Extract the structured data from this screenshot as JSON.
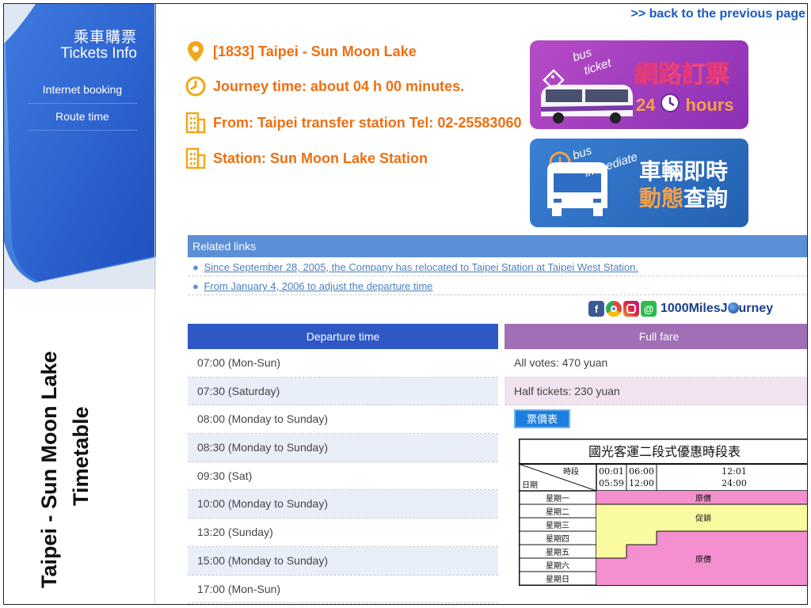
{
  "sidebar": {
    "brand_zh": "乘車購票",
    "brand_en": "Tickets Info",
    "nav": [
      {
        "label": "Internet booking"
      },
      {
        "label": "Route time"
      }
    ],
    "vertical_title_line1": "Taipei - Sun Moon Lake",
    "vertical_title_line2": "Timetable"
  },
  "header": {
    "back_link": ">> back to the previous page"
  },
  "route": {
    "name": "[1833] Taipei - Sun Moon Lake",
    "journey": "Journey time: about 04 h 00 minutes.",
    "from": "From: Taipei transfer station Tel: 02-25583060",
    "station": "Station: Sun Moon Lake Station"
  },
  "banners": {
    "ticket": {
      "small1": "bus",
      "small2": "ticket",
      "title": "網路訂票",
      "hours_num": "24",
      "hours_word": "hours"
    },
    "bus": {
      "small1": "bus",
      "small2": "immediate",
      "line1": "車輛即時",
      "line2_a": "動態",
      "line2_b": "查詢"
    }
  },
  "related": {
    "heading": "Related links",
    "links": [
      "Since September 28, 2005, the Company has relocated to Taipei Station at Taipei West Station.",
      "From January 4, 2006 to adjust the departure time"
    ]
  },
  "social": {
    "brand": "1000MilesJ",
    "brand_tail": "urney"
  },
  "schedule": {
    "departure_header": "Departure time",
    "departures": [
      "07:00 (Mon-Sun)",
      "07:30 (Saturday)",
      "08:00 (Monday to Sunday)",
      "08:30 (Monday to Sunday)",
      "09:30 (Sat)",
      "10:00 (Monday to Sunday)",
      "13:20 (Sunday)",
      "15:00 (Monday to Sunday)",
      "17:00 (Mon-Sun)"
    ],
    "fare_header": "Full fare",
    "fares": [
      "All votes: 470 yuan",
      "Half tickets: 230 yuan"
    ],
    "fare_button": "票價表"
  },
  "promo_table": {
    "title": "國光客運二段式優惠時段表",
    "corner_top": "時段",
    "corner_bottom": "日期",
    "col1": [
      "00:01",
      "05:59"
    ],
    "col2": [
      "06:00",
      "12:00"
    ],
    "col3": [
      "12:01",
      "24:00"
    ],
    "days": [
      "星期一",
      "星期二",
      "星期三",
      "星期四",
      "星期五",
      "星期六",
      "星期日"
    ],
    "label_full": "原價",
    "label_promo": "促銷",
    "label_full2": "原價"
  },
  "colors": {
    "orange": "#ef6f11",
    "blue": "#2f58c5",
    "purple": "#a16fb6",
    "pink": "#f48fd0",
    "yellow": "#fafaa0"
  }
}
